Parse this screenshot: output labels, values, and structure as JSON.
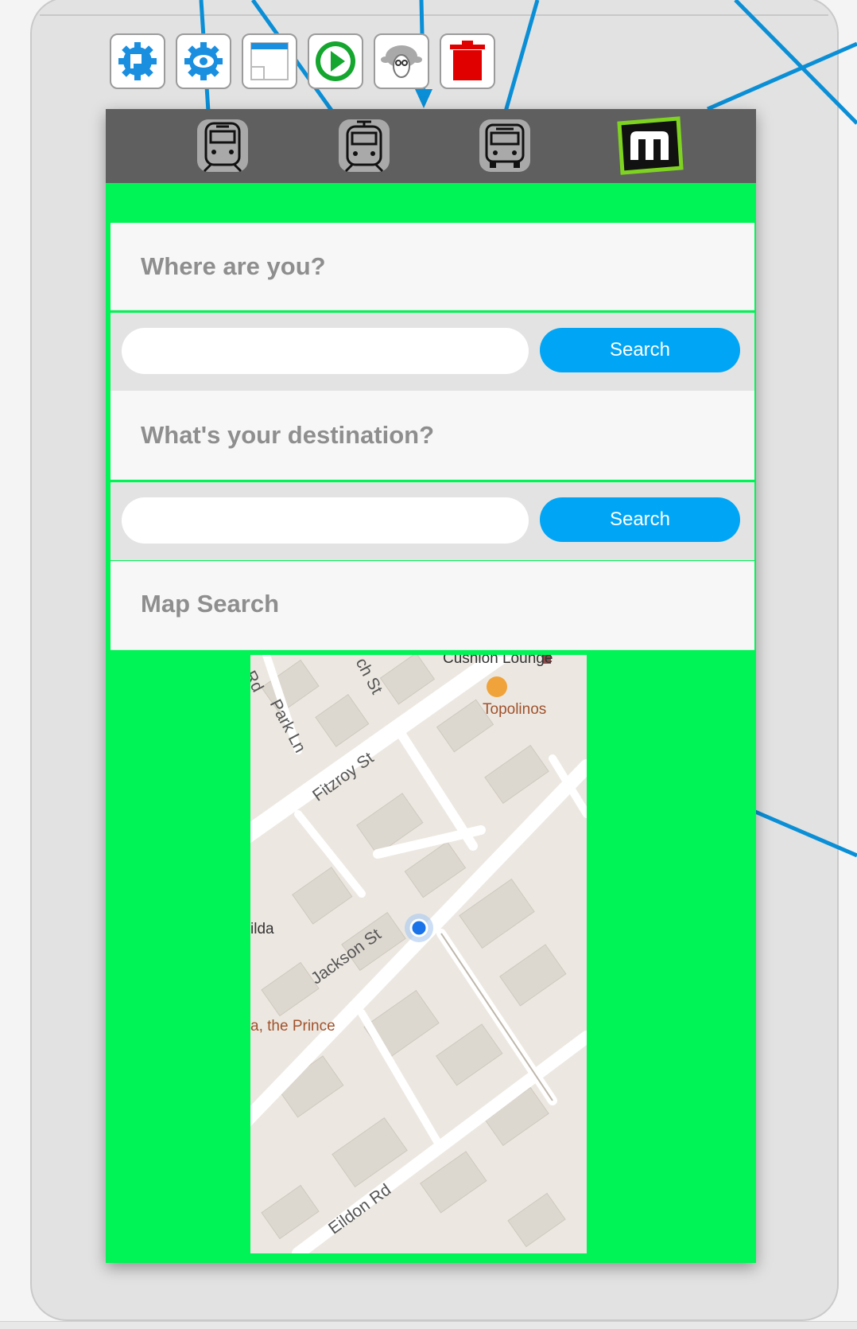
{
  "toolbar": {
    "buttons": [
      {
        "name": "settings-blue-gear",
        "icon": "gear-icon"
      },
      {
        "name": "view-gear",
        "icon": "eye-gear-icon"
      },
      {
        "name": "blank-page",
        "icon": "page-icon"
      },
      {
        "name": "play",
        "icon": "play-icon"
      },
      {
        "name": "sheep-avatar",
        "icon": "sheep-icon"
      },
      {
        "name": "delete",
        "icon": "trash-icon"
      }
    ]
  },
  "nav": {
    "items": [
      {
        "name": "train",
        "icon": "train-icon"
      },
      {
        "name": "tram",
        "icon": "tram-icon"
      },
      {
        "name": "bus",
        "icon": "bus-icon"
      },
      {
        "name": "myki",
        "icon": "m-logo-icon"
      }
    ]
  },
  "sections": {
    "origin_title": "Where are you?",
    "destination_title": "What's your destination?",
    "map_title": "Map Search"
  },
  "origin": {
    "value": "",
    "placeholder": "",
    "search_label": "Search"
  },
  "destination": {
    "value": "",
    "placeholder": "",
    "search_label": "Search"
  },
  "map": {
    "streets": [
      "Fitzroy St",
      "Jackson St",
      "Eildon Rd",
      "Park Ln",
      "ch St",
      "Rd"
    ],
    "pois": [
      "Cushion Lounge",
      "Topolinos",
      "ilda",
      "a, the Prince"
    ]
  },
  "colors": {
    "accent_green": "#00f455",
    "nav_gray": "#5f5f5f",
    "search_blue": "#00a6f5",
    "connector_blue": "#0a8fd6"
  }
}
